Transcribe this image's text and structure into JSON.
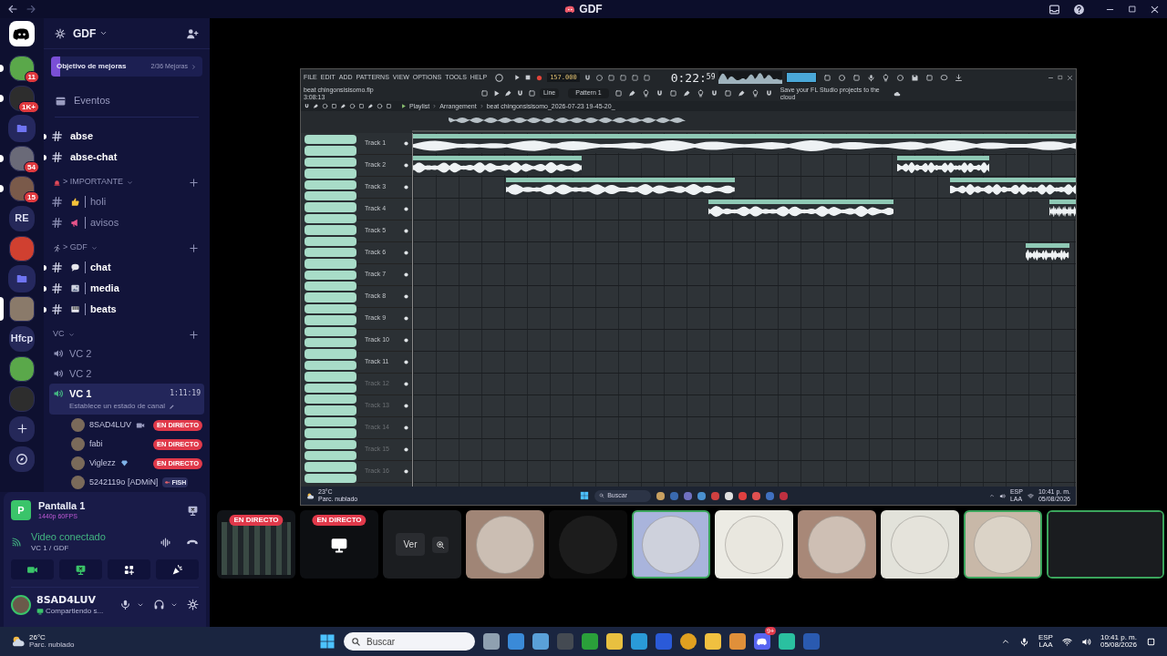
{
  "titlebar": {
    "title": "GDF"
  },
  "servers": [
    {
      "kind": "home",
      "unread": false,
      "selected": false
    },
    {
      "kind": "avatar",
      "badge": "11",
      "unread": true,
      "selected": false
    },
    {
      "kind": "avatar",
      "badge": "1K+",
      "unread": true,
      "selected": false
    },
    {
      "kind": "folder",
      "unread": false,
      "selected": false
    },
    {
      "kind": "avatar",
      "badge": "54",
      "unread": true,
      "selected": false
    },
    {
      "kind": "avatar",
      "badge": "15",
      "unread": true,
      "selected": false
    },
    {
      "kind": "text",
      "label": "RE",
      "unread": false,
      "selected": false
    },
    {
      "kind": "avatar",
      "unread": false,
      "selected": false
    },
    {
      "kind": "folder",
      "unread": false,
      "selected": false
    },
    {
      "kind": "avatar",
      "unread": false,
      "selected": true
    },
    {
      "kind": "text",
      "label": "Hfcp",
      "unread": false,
      "selected": false
    },
    {
      "kind": "avatar",
      "unread": false,
      "selected": false
    },
    {
      "kind": "avatar",
      "unread": false,
      "selected": false
    },
    {
      "kind": "add",
      "unread": false,
      "selected": false
    },
    {
      "kind": "explore",
      "unread": false,
      "selected": false
    }
  ],
  "server": {
    "name": "GDF"
  },
  "boost": {
    "label": "Objetivo de mejoras",
    "progress": "2/36 Mejoras",
    "level": 0.06
  },
  "events": {
    "label": "Eventos"
  },
  "top_channels": [
    {
      "name": "abse",
      "unread": true
    },
    {
      "name": "abse-chat",
      "unread": true
    }
  ],
  "categories": [
    {
      "kind": "alert",
      "name": "> IMPORTANTE",
      "channels": [
        {
          "name": "holi",
          "unread": false
        },
        {
          "name": "avisos",
          "unread": false
        }
      ]
    },
    {
      "kind": "runner",
      "name": "> GDF",
      "channels": [
        {
          "name": "chat",
          "unread": true
        },
        {
          "name": "media",
          "unread": true
        },
        {
          "name": "beats",
          "unread": true
        }
      ]
    }
  ],
  "voice": {
    "category": "VC",
    "channels": [
      {
        "name": "VC 2",
        "selected": false
      },
      {
        "name": "VC 2",
        "selected": false
      },
      {
        "name": "VC 1",
        "selected": true,
        "timer": "1:11:19",
        "status": "Establece un estado de canal",
        "members": [
          {
            "name": "8SAD4LUV",
            "video": true,
            "badge": "EN DIRECTO"
          },
          {
            "name": "fabi",
            "video": false,
            "badge": "EN DIRECTO"
          },
          {
            "name": "Viglezz",
            "video": false,
            "gem": true,
            "badge": "EN DIRECTO"
          },
          {
            "name": "5242119o [ADMiN]",
            "video": false,
            "tag": "FISH"
          }
        ]
      }
    ]
  },
  "voice_panel": {
    "icon_letter": "P",
    "stream_title": "Pantalla 1",
    "quality": "1440p 60FPS",
    "status": "Video conectado",
    "channel": "VC 1 / GDF"
  },
  "user": {
    "name": "8SAD4LUV",
    "status": "Compartiendo s..."
  },
  "daw": {
    "menu": [
      "FILE",
      "EDIT",
      "ADD",
      "PATTERNS",
      "VIEW",
      "OPTIONS",
      "TOOLS",
      "HELP"
    ],
    "tempo": "157.000",
    "time": "0:22:",
    "time_small": "59",
    "project": "beat chingonsisisomo.flp",
    "project_time": "3:08:13",
    "snap": "Line",
    "pattern": "Pattern 1",
    "hint": "Save your FL Studio projects to the cloud",
    "breadcrumb": [
      "Playlist",
      "Arrangement",
      "beat chingonsisisomo_2026-07-23 19-45-20_"
    ],
    "tracks": [
      "Track 1",
      "Track 2",
      "Track 3",
      "Track 4",
      "Track 5",
      "Track 6",
      "Track 7",
      "Track 8",
      "Track 9",
      "Track 10",
      "Track 11",
      "Track 12",
      "Track 13",
      "Track 14",
      "Track 15",
      "Track 16"
    ],
    "os_taskbar": {
      "temp": "23°C",
      "weather": "Parc. nublado",
      "search": "Buscar",
      "lang": "ESP",
      "layout": "LAA",
      "time": "10:41 p. m.",
      "date": "05/08/2026"
    }
  },
  "tiles": [
    {
      "kind": "stream",
      "badge": "EN DIRECTO",
      "speaking": false
    },
    {
      "kind": "stream_hidden",
      "badge": "EN DIRECTO",
      "speaking": false
    },
    {
      "kind": "locked",
      "button": "Ver",
      "speaking": false
    },
    {
      "kind": "avatar",
      "speaking": false
    },
    {
      "kind": "dark",
      "speaking": false
    },
    {
      "kind": "avatar",
      "speaking": true
    },
    {
      "kind": "avatar",
      "speaking": false
    },
    {
      "kind": "avatar",
      "speaking": false
    },
    {
      "kind": "avatar",
      "speaking": false
    },
    {
      "kind": "avatar",
      "speaking": true
    },
    {
      "kind": "camera",
      "speaking": true
    }
  ],
  "taskbar": {
    "temp": "26°C",
    "weather": "Parc. nublado",
    "search": "Buscar",
    "apps": [
      {
        "kind": "files"
      },
      {
        "kind": "store"
      },
      {
        "kind": "photos"
      },
      {
        "kind": "clapper"
      },
      {
        "kind": "xbox"
      },
      {
        "kind": "coin"
      },
      {
        "kind": "edge"
      },
      {
        "kind": "cube"
      },
      {
        "kind": "chrome"
      },
      {
        "kind": "folder"
      },
      {
        "kind": "player"
      },
      {
        "kind": "discord",
        "badge": "9+"
      },
      {
        "kind": "chat"
      },
      {
        "kind": "word"
      }
    ],
    "lang": "ESP",
    "layout": "LAA",
    "time": "10:41 p. m.",
    "date": "05/08/2026"
  }
}
